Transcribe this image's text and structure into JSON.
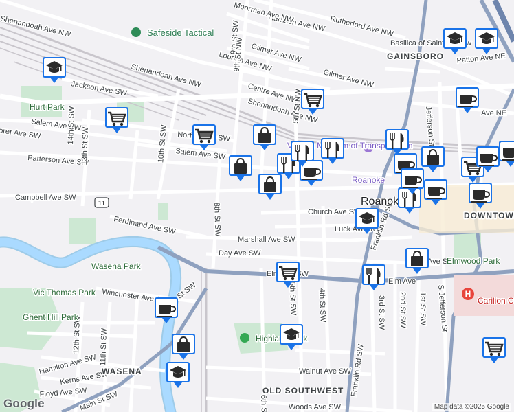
{
  "roads": [
    "Shenandoah Ave NW",
    "Shenandoah Ave NW",
    "Shenandoah Ave NW",
    "Harrison Ave NW",
    "Rutherford Ave NW",
    "Moorman Ave NW",
    "Gilmer Ave NW",
    "Gilmer Ave NW",
    "Loudon Ave NW",
    "Centre Ave NW",
    "Patton Ave NE",
    "Jackson Ave SW",
    "Salem Ave SW",
    "Salem Ave SW",
    "Norfolk Ave SW",
    "Patterson Ave SW",
    "Campbell Ave SW",
    "Church Ave SW",
    "Luck Ave SW",
    "Marshall Ave SW",
    "Ferdinand Ave SW",
    "Day Ave SW",
    "Elm Ave SW",
    "Winchester Ave SW",
    "Main St SW",
    "Main St SW",
    "Hamilton Ave SW",
    "Kerns Ave SW",
    "Floyd Ave SW",
    "Walnut Ave SW",
    "Woods Ave SW",
    "Franklin Rd SW",
    "Franklin Rd SW",
    "Jefferson St",
    "S Jefferson St",
    "5th St SW",
    "4th St SW",
    "6th St SW",
    "8th St SW",
    "10th St SW",
    "12th St SW",
    "13th St SW",
    "14th St SW",
    "11th St SW",
    "9th St SW",
    "3rd St SW",
    "2nd St SW",
    "1st St SW",
    "9th St NW",
    "5th St NW",
    "Elm Ave",
    "Ave NE",
    "Rorer Ave SW",
    "Ave SW"
  ],
  "areas": [
    "GAINSBORO",
    "DOWNTOWN ROANOKE",
    "WASENA",
    "OLD SOUTHWEST"
  ],
  "places": {
    "poi_safeside": "Safeside Tactical",
    "poi_basilica": "Basilica of Saint Andrew",
    "poi_museum": "Virginia Museum of Transportation",
    "poi_roanoke_label": "Roanoke",
    "poi_carilion": "Carilion Community",
    "city_roanoke": "Roanoke",
    "parks": [
      "Hurt Park",
      "Wasena Park",
      "Vic Thomas Park",
      "Ghent Hill Park",
      "Highland Park",
      "Elmwood Park"
    ]
  },
  "route_shield": "11",
  "markers": [
    {
      "type": "school-icon"
    },
    {
      "type": "school-icon"
    },
    {
      "type": "school-icon"
    },
    {
      "type": "cart-icon"
    },
    {
      "type": "cart-icon"
    },
    {
      "type": "cart-icon"
    },
    {
      "type": "bag-icon"
    },
    {
      "type": "bag-icon"
    },
    {
      "type": "bag-icon"
    },
    {
      "type": "cup-icon"
    },
    {
      "type": "cup-icon"
    },
    {
      "type": "fork-knife-icon"
    },
    {
      "type": "fork-knife-icon"
    },
    {
      "type": "fork-knife-icon"
    },
    {
      "type": "school-icon"
    },
    {
      "type": "cart-icon"
    },
    {
      "type": "fork-knife-icon"
    },
    {
      "type": "cup-icon"
    },
    {
      "type": "bag-icon"
    },
    {
      "type": "school-icon"
    },
    {
      "type": "bag-icon"
    },
    {
      "type": "school-icon"
    },
    {
      "type": "cart-icon"
    },
    {
      "type": "fork-knife-icon"
    },
    {
      "type": "cup-icon"
    },
    {
      "type": "cup-icon"
    },
    {
      "type": "bag-icon"
    },
    {
      "type": "cart-icon"
    },
    {
      "type": "cup-icon"
    },
    {
      "type": "fork-knife-icon"
    },
    {
      "type": "cup-icon"
    },
    {
      "type": "cup-icon"
    },
    {
      "type": "cup-icon"
    }
  ],
  "attribution": "Map data ©2025 Google",
  "logo": "Google"
}
